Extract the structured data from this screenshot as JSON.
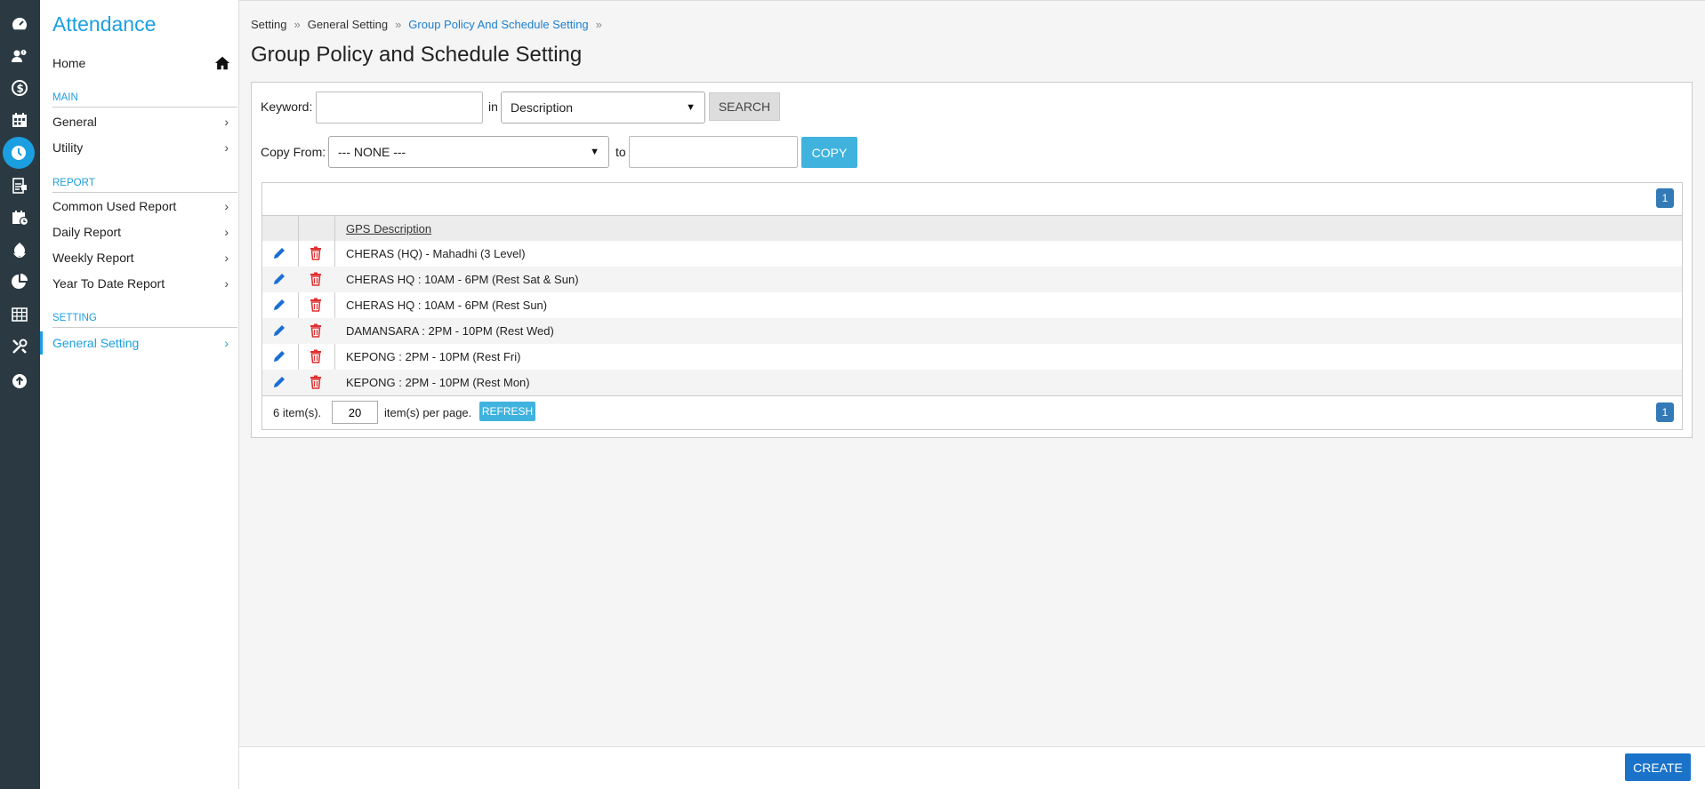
{
  "sidebar": {
    "title": "Attendance",
    "home_label": "Home",
    "sections": {
      "main": "MAIN",
      "report": "REPORT",
      "setting": "SETTING"
    },
    "items": {
      "general": "General",
      "utility": "Utility",
      "common_used_report": "Common Used Report",
      "daily_report": "Daily Report",
      "weekly_report": "Weekly Report",
      "year_to_date_report": "Year To Date Report",
      "general_setting": "General Setting"
    },
    "chevron": "›"
  },
  "rail_icons": [
    "dashboard-icon",
    "users-icon",
    "payroll-icon",
    "calendar-icon",
    "clock-icon",
    "document-icon",
    "schedule-icon",
    "leaf-icon",
    "chart-icon",
    "table-icon",
    "tools-icon",
    "upload-icon"
  ],
  "breadcrumb": {
    "items": [
      "Setting",
      "General Setting",
      "Group Policy And Schedule Setting"
    ],
    "separator": "»"
  },
  "page_title": "Group Policy and Schedule Setting",
  "search": {
    "keyword_label": "Keyword:",
    "keyword_value": "",
    "in_label": "in",
    "field_selected": "Description",
    "search_button": "SEARCH"
  },
  "copy": {
    "from_label": "Copy From:",
    "from_selected": "--- NONE ---",
    "to_label": "to",
    "to_value": "",
    "copy_button": "COPY"
  },
  "grid": {
    "page": "1",
    "column_header": "GPS Description",
    "rows": [
      "CHERAS (HQ) - Mahadhi (3 Level)",
      "CHERAS HQ : 10AM - 6PM (Rest Sat & Sun)",
      "CHERAS HQ : 10AM - 6PM (Rest Sun)",
      "DAMANSARA : 2PM - 10PM (Rest Wed)",
      "KEPONG : 2PM - 10PM (Rest Fri)",
      "KEPONG : 2PM - 10PM (Rest Mon)"
    ],
    "items_count": "6 item(s).",
    "per_page_value": "20",
    "per_page_label": "item(s) per page.",
    "refresh_button": "REFRESH"
  },
  "create_button": "CREATE",
  "colors": {
    "accent": "#1b9fe0",
    "rail": "#2b3a42",
    "edit_icon": "#1a6fd6",
    "delete_icon": "#e03030"
  }
}
